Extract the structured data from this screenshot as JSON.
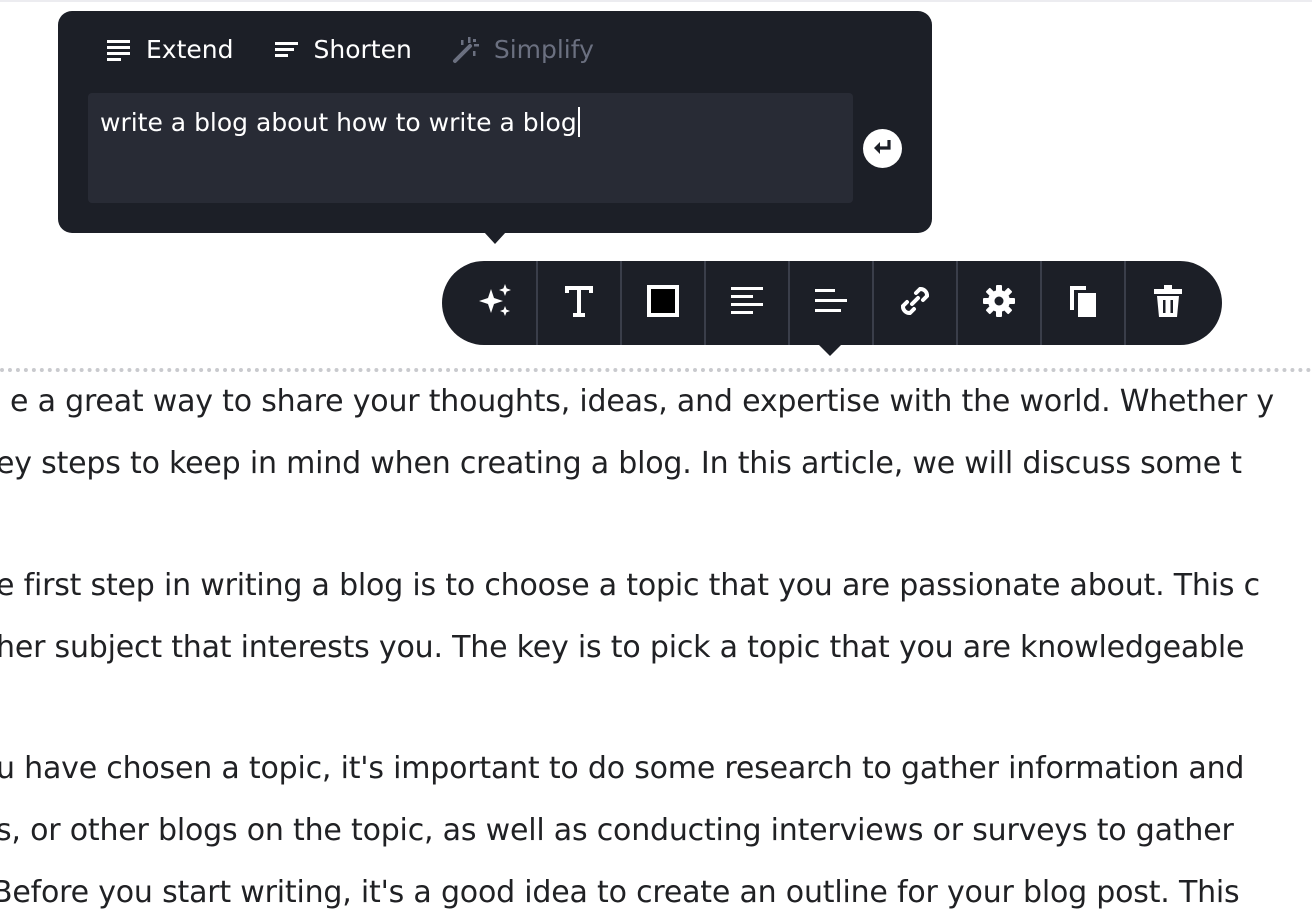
{
  "ai_popover": {
    "actions": [
      {
        "label": "Extend",
        "icon": "lines-full-icon",
        "enabled": true
      },
      {
        "label": "Shorten",
        "icon": "lines-short-icon",
        "enabled": true
      },
      {
        "label": "Simplify",
        "icon": "magic-wand-icon",
        "enabled": false
      }
    ],
    "prompt_value": "write a blog about how to write a blog",
    "submit_icon": "enter-arrow-icon"
  },
  "format_toolbar": {
    "buttons": [
      {
        "icon": "sparkles-icon",
        "name": "ai-assist"
      },
      {
        "icon": "text-icon",
        "name": "text-style"
      },
      {
        "icon": "square-icon",
        "name": "block-style"
      },
      {
        "icon": "align-left-icon",
        "name": "align-left"
      },
      {
        "icon": "align-center-icon",
        "name": "align-center"
      },
      {
        "icon": "link-icon",
        "name": "link"
      },
      {
        "icon": "gear-icon",
        "name": "settings"
      },
      {
        "icon": "copy-icon",
        "name": "duplicate"
      },
      {
        "icon": "trash-icon",
        "name": "delete"
      }
    ]
  },
  "article": {
    "lines": [
      "e a great way to share your thoughts, ideas, and expertise with the world. Whether y",
      "ey steps to keep in mind when creating a blog. In this article, we will discuss some t",
      "",
      "e first step in writing a blog is to choose a topic that you are passionate about. This c",
      "her subject that interests you. The key is to pick a topic that you are knowledgeable",
      "",
      "u have chosen a topic, it's important to do some research to gather information and",
      "s, or other blogs on the topic, as well as conducting interviews or surveys to gather",
      "Before you start writing, it's a good idea to create an outline for your blog post. This"
    ]
  },
  "colors": {
    "popover_bg": "#1c1f27",
    "prompt_bg": "#282b35",
    "disabled_text": "#6b7080",
    "body_text": "#202124"
  }
}
